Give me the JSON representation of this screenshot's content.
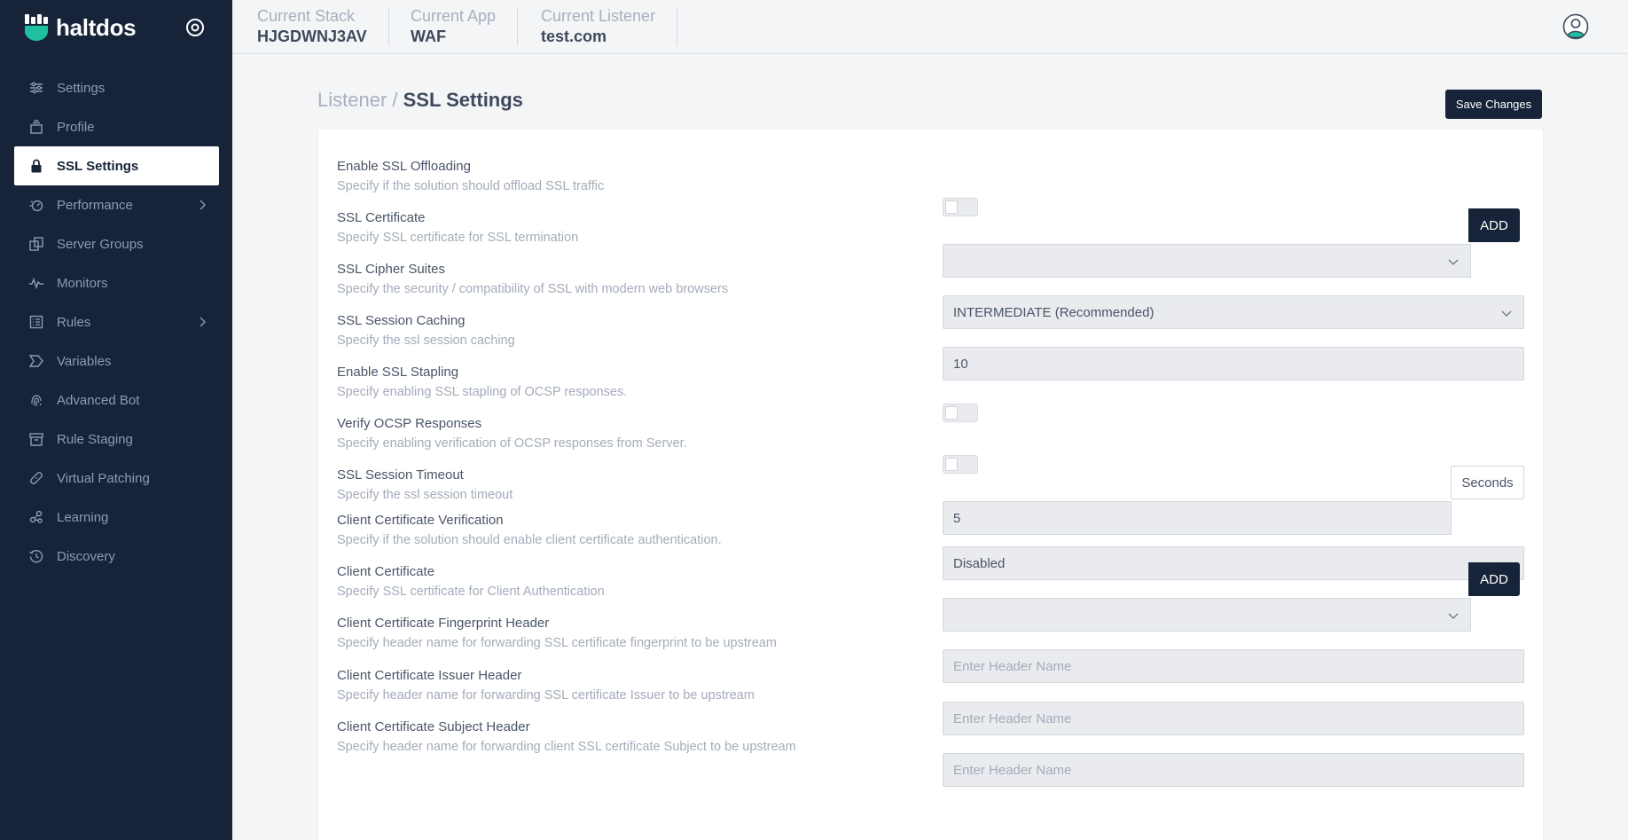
{
  "brand": {
    "name": "haltdos"
  },
  "topbar": {
    "contexts": [
      {
        "label": "Current Stack",
        "value": "HJGDWNJ3AV"
      },
      {
        "label": "Current App",
        "value": "WAF"
      },
      {
        "label": "Current Listener",
        "value": "test.com"
      }
    ]
  },
  "sidebar": {
    "items": [
      {
        "label": "Settings",
        "icon": "sliders-icon"
      },
      {
        "label": "Profile",
        "icon": "stack-icon"
      },
      {
        "label": "SSL Settings",
        "icon": "lock-icon",
        "active": true
      },
      {
        "label": "Performance",
        "icon": "speedometer-icon",
        "expandable": true
      },
      {
        "label": "Server Groups",
        "icon": "copy-icon"
      },
      {
        "label": "Monitors",
        "icon": "pulse-icon"
      },
      {
        "label": "Rules",
        "icon": "list-icon",
        "expandable": true
      },
      {
        "label": "Variables",
        "icon": "tag-icon"
      },
      {
        "label": "Advanced Bot",
        "icon": "fingerprint-icon"
      },
      {
        "label": "Rule Staging",
        "icon": "archive-icon"
      },
      {
        "label": "Virtual Patching",
        "icon": "bandage-icon"
      },
      {
        "label": "Learning",
        "icon": "graph-icon"
      },
      {
        "label": "Discovery",
        "icon": "history-icon"
      }
    ]
  },
  "breadcrumb": {
    "parent": "Listener",
    "separator": " / ",
    "current": "SSL Settings"
  },
  "actions": {
    "save_label": "Save Changes"
  },
  "settings": [
    {
      "label": "Enable SSL Offloading",
      "desc": "Specify if the solution should offload SSL traffic",
      "control": "toggle",
      "checked": false
    },
    {
      "label": "SSL Certificate",
      "desc": "Specify SSL certificate for SSL termination",
      "control": "select-add",
      "value": "",
      "add_label": "ADD"
    },
    {
      "label": "SSL Cipher Suites",
      "desc": "Specify the security / compatibility of SSL with modern web browsers",
      "control": "select",
      "value": "INTERMEDIATE (Recommended)"
    },
    {
      "label": "SSL Session Caching",
      "desc": "Specify the ssl session caching",
      "control": "input",
      "value": "10"
    },
    {
      "label": "Enable SSL Stapling",
      "desc": "Specify enabling SSL stapling of OCSP responses.",
      "control": "toggle",
      "checked": false
    },
    {
      "label": "Verify OCSP Responses",
      "desc": "Specify enabling verification of OCSP responses from Server.",
      "control": "toggle",
      "checked": false
    },
    {
      "label": "SSL Session Timeout",
      "desc": "Specify the ssl session timeout",
      "control": "input-suffix",
      "value": "5",
      "suffix": "Seconds"
    },
    {
      "label": "Client Certificate Verification",
      "desc": "Specify if the solution should enable client certificate authentication.",
      "control": "select",
      "value": "Disabled"
    },
    {
      "label": "Client Certificate",
      "desc": "Specify SSL certificate for Client Authentication",
      "control": "select-add",
      "value": "",
      "add_label": "ADD"
    },
    {
      "label": "Client Certificate Fingerprint Header",
      "desc": "Specify header name for forwarding SSL certificate fingerprint to be upstream",
      "control": "input",
      "value": "",
      "placeholder": "Enter Header Name"
    },
    {
      "label": "Client Certificate Issuer Header",
      "desc": "Specify header name for forwarding SSL certificate Issuer to be upstream",
      "control": "input",
      "value": "",
      "placeholder": "Enter Header Name"
    },
    {
      "label": "Client Certificate Subject Header",
      "desc": "Specify header name for forwarding client SSL certificate Subject to be upstream",
      "control": "input",
      "value": "",
      "placeholder": "Enter Header Name"
    }
  ],
  "colors": {
    "sidebar_bg": "#162338",
    "accent": "#162338",
    "page_bg": "#f4f5f7"
  }
}
